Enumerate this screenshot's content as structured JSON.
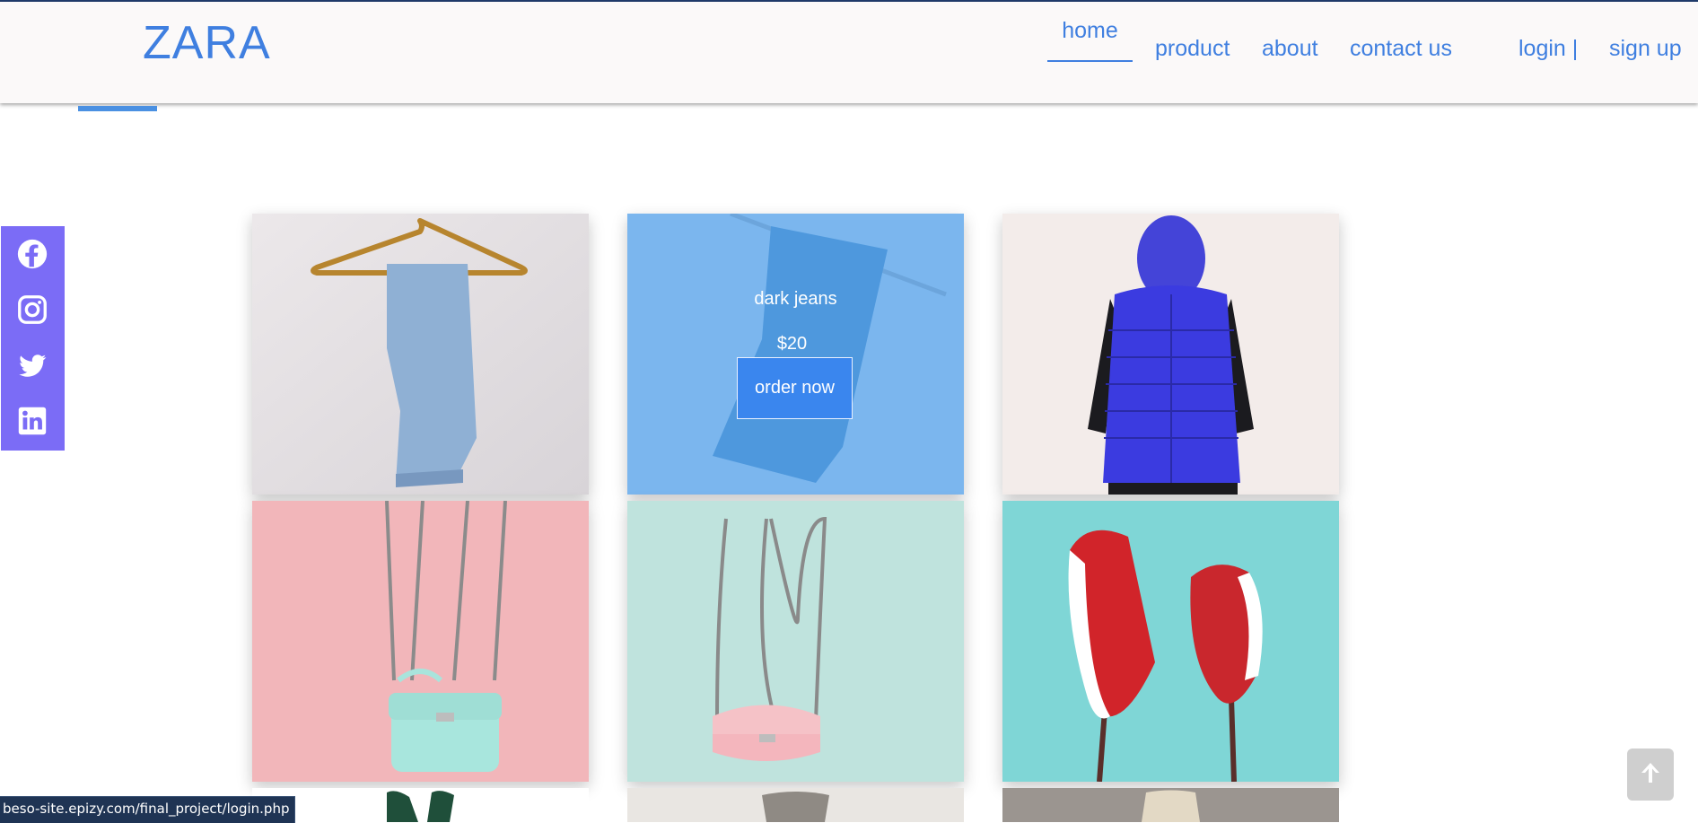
{
  "header": {
    "logo": "ZARA",
    "nav": {
      "home": "home",
      "product": "product",
      "about": "about",
      "contact": "contact us",
      "login": "login |",
      "signup": "sign up"
    }
  },
  "social": {
    "icons": [
      "facebook-icon",
      "instagram-icon",
      "twitter-icon",
      "linkedin-icon"
    ],
    "color": "#7b6cf6"
  },
  "products": {
    "hovered": {
      "name": "dark jeans",
      "price": "$20",
      "button": "order now"
    }
  },
  "status_bar": {
    "url": "beso-site.epizy.com/final_project/login.php"
  },
  "colors": {
    "brand": "#3f7fe0",
    "accent": "#4a90e2",
    "overlay": "#5aa5eb"
  }
}
